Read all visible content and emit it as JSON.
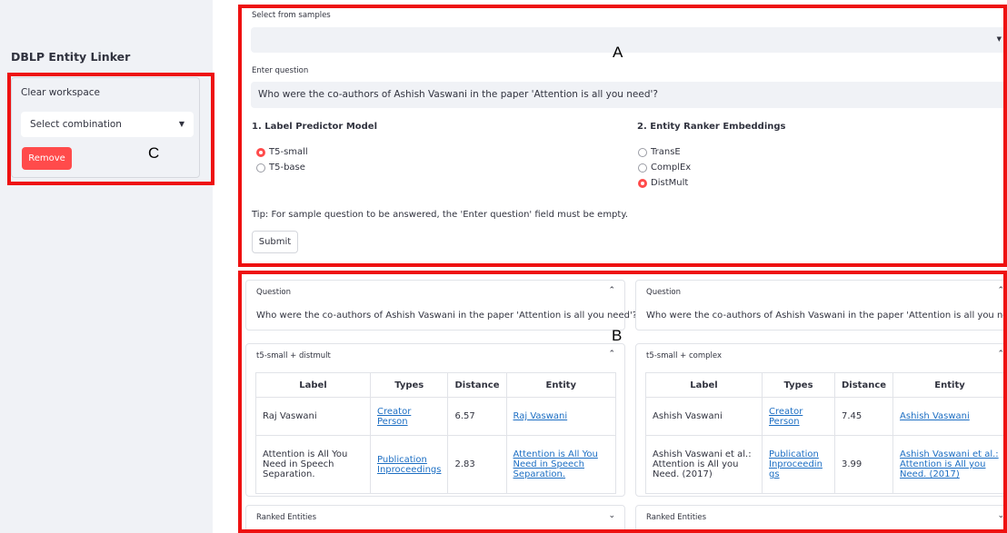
{
  "sidebar": {
    "app_title": "DBLP Entity Linker",
    "clear_label": "Clear workspace",
    "combination_placeholder": "Select combination",
    "remove_label": "Remove"
  },
  "form": {
    "samples_label": "Select from samples",
    "samples_value": "",
    "question_label": "Enter question",
    "question_value": "Who were the co-authors of Ashish Vaswani in the paper 'Attention is all you need'?",
    "label_model_heading": "1. Label Predictor Model",
    "label_models": [
      {
        "label": "T5-small",
        "selected": true
      },
      {
        "label": "T5-base",
        "selected": false
      }
    ],
    "ranker_heading": "2. Entity Ranker Embeddings",
    "rankers": [
      {
        "label": "TransE",
        "selected": false
      },
      {
        "label": "ComplEx",
        "selected": false
      },
      {
        "label": "DistMult",
        "selected": true
      }
    ],
    "tip": "Tip: For sample question to be answered, the 'Enter question' field must be empty.",
    "submit_label": "Submit"
  },
  "results": {
    "headers": [
      "Label",
      "Types",
      "Distance",
      "Entity"
    ],
    "ranked_label": "Ranked Entities",
    "left": {
      "question_title": "Question",
      "question_text": "Who were the co-authors of Ashish Vaswani in the paper 'Attention is all you need'?",
      "combo_title": "t5-small + distmult",
      "rows": [
        {
          "label": "Raj Vaswani",
          "types": [
            "Creator",
            "Person"
          ],
          "distance": "6.57",
          "entity": "Raj Vaswani"
        },
        {
          "label": "Attention is All You Need in Speech Separation.",
          "types": [
            "Publication",
            "Inproceedings"
          ],
          "distance": "2.83",
          "entity": "Attention is All You Need in Speech Separation."
        }
      ]
    },
    "right": {
      "question_title": "Question",
      "question_text": "Who were the co-authors of Ashish Vaswani in the paper 'Attention is all you need'?",
      "combo_title": "t5-small + complex",
      "rows": [
        {
          "label": "Ashish Vaswani",
          "types": [
            "Creator",
            "Person"
          ],
          "distance": "7.45",
          "entity": "Ashish Vaswani"
        },
        {
          "label": "Ashish Vaswani et al.: Attention is All you Need. (2017)",
          "types": [
            "Publication",
            "Inproceedings"
          ],
          "distance": "3.99",
          "entity": "Ashish Vaswani et al.: Attention is All you Need. (2017)"
        }
      ]
    }
  },
  "annotations": {
    "a": "A",
    "b": "B",
    "c": "C"
  },
  "colors": {
    "accent": "#ff4b4b",
    "annotation": "#ee1111",
    "link": "#1c6ec3"
  }
}
